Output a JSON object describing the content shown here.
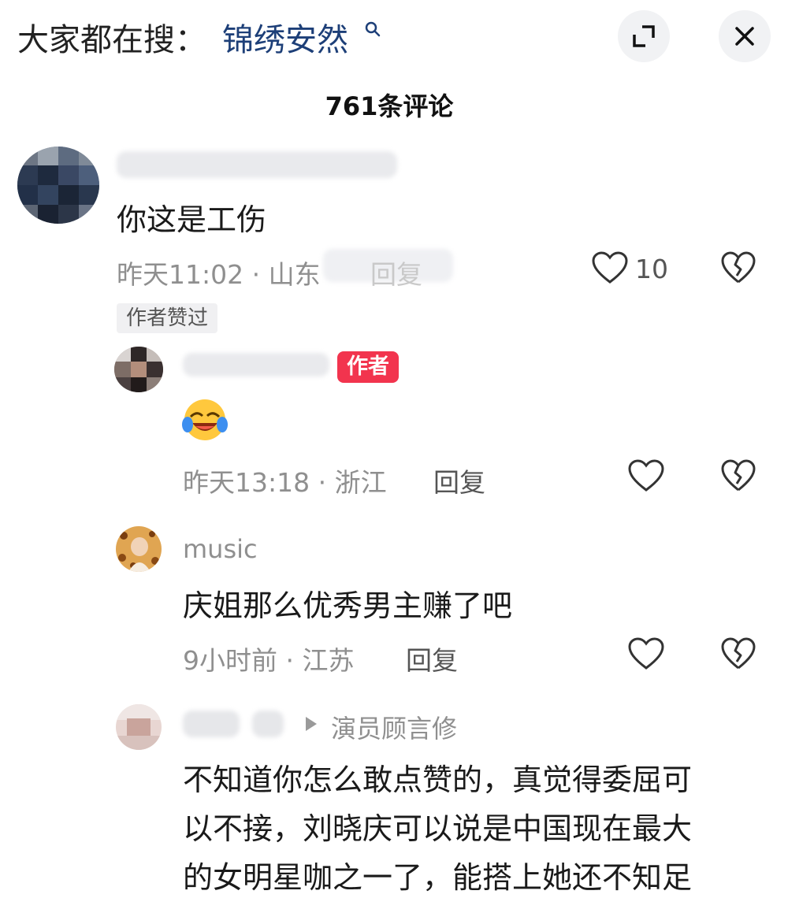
{
  "top_bar": {
    "search_prefix": "大家都在搜：",
    "search_term": "锦绣安然",
    "expand_icon": "expand-icon",
    "close_icon": "close-icon"
  },
  "title": "761条评论",
  "comments": [
    {
      "text": "你这是工伤",
      "time_location": "昨天11:02 · 山东",
      "reply_label": "回复",
      "like_count": "10",
      "badge": "作者赞过"
    },
    {
      "author_badge": "作者",
      "emoji": "laughing-crying-emoji",
      "time_location": "昨天13:18 · 浙江",
      "reply_label": "回复"
    },
    {
      "username": "music",
      "text": "庆姐那么优秀男主赚了吧",
      "time_location": "9小时前 · 江苏",
      "reply_label": "回复"
    },
    {
      "reply_to": "演员顾言修",
      "lines": [
        "不知道你怎么敢点赞的，真觉得委屈可",
        "以不接，刘晓庆可以说是中国现在最大",
        "的女明星咖之一了，能搭上她还不知足"
      ]
    }
  ],
  "colors": {
    "search_term": "#1d3f78",
    "author_badge": "#f2344e",
    "meta_text": "#8f8f8f"
  }
}
